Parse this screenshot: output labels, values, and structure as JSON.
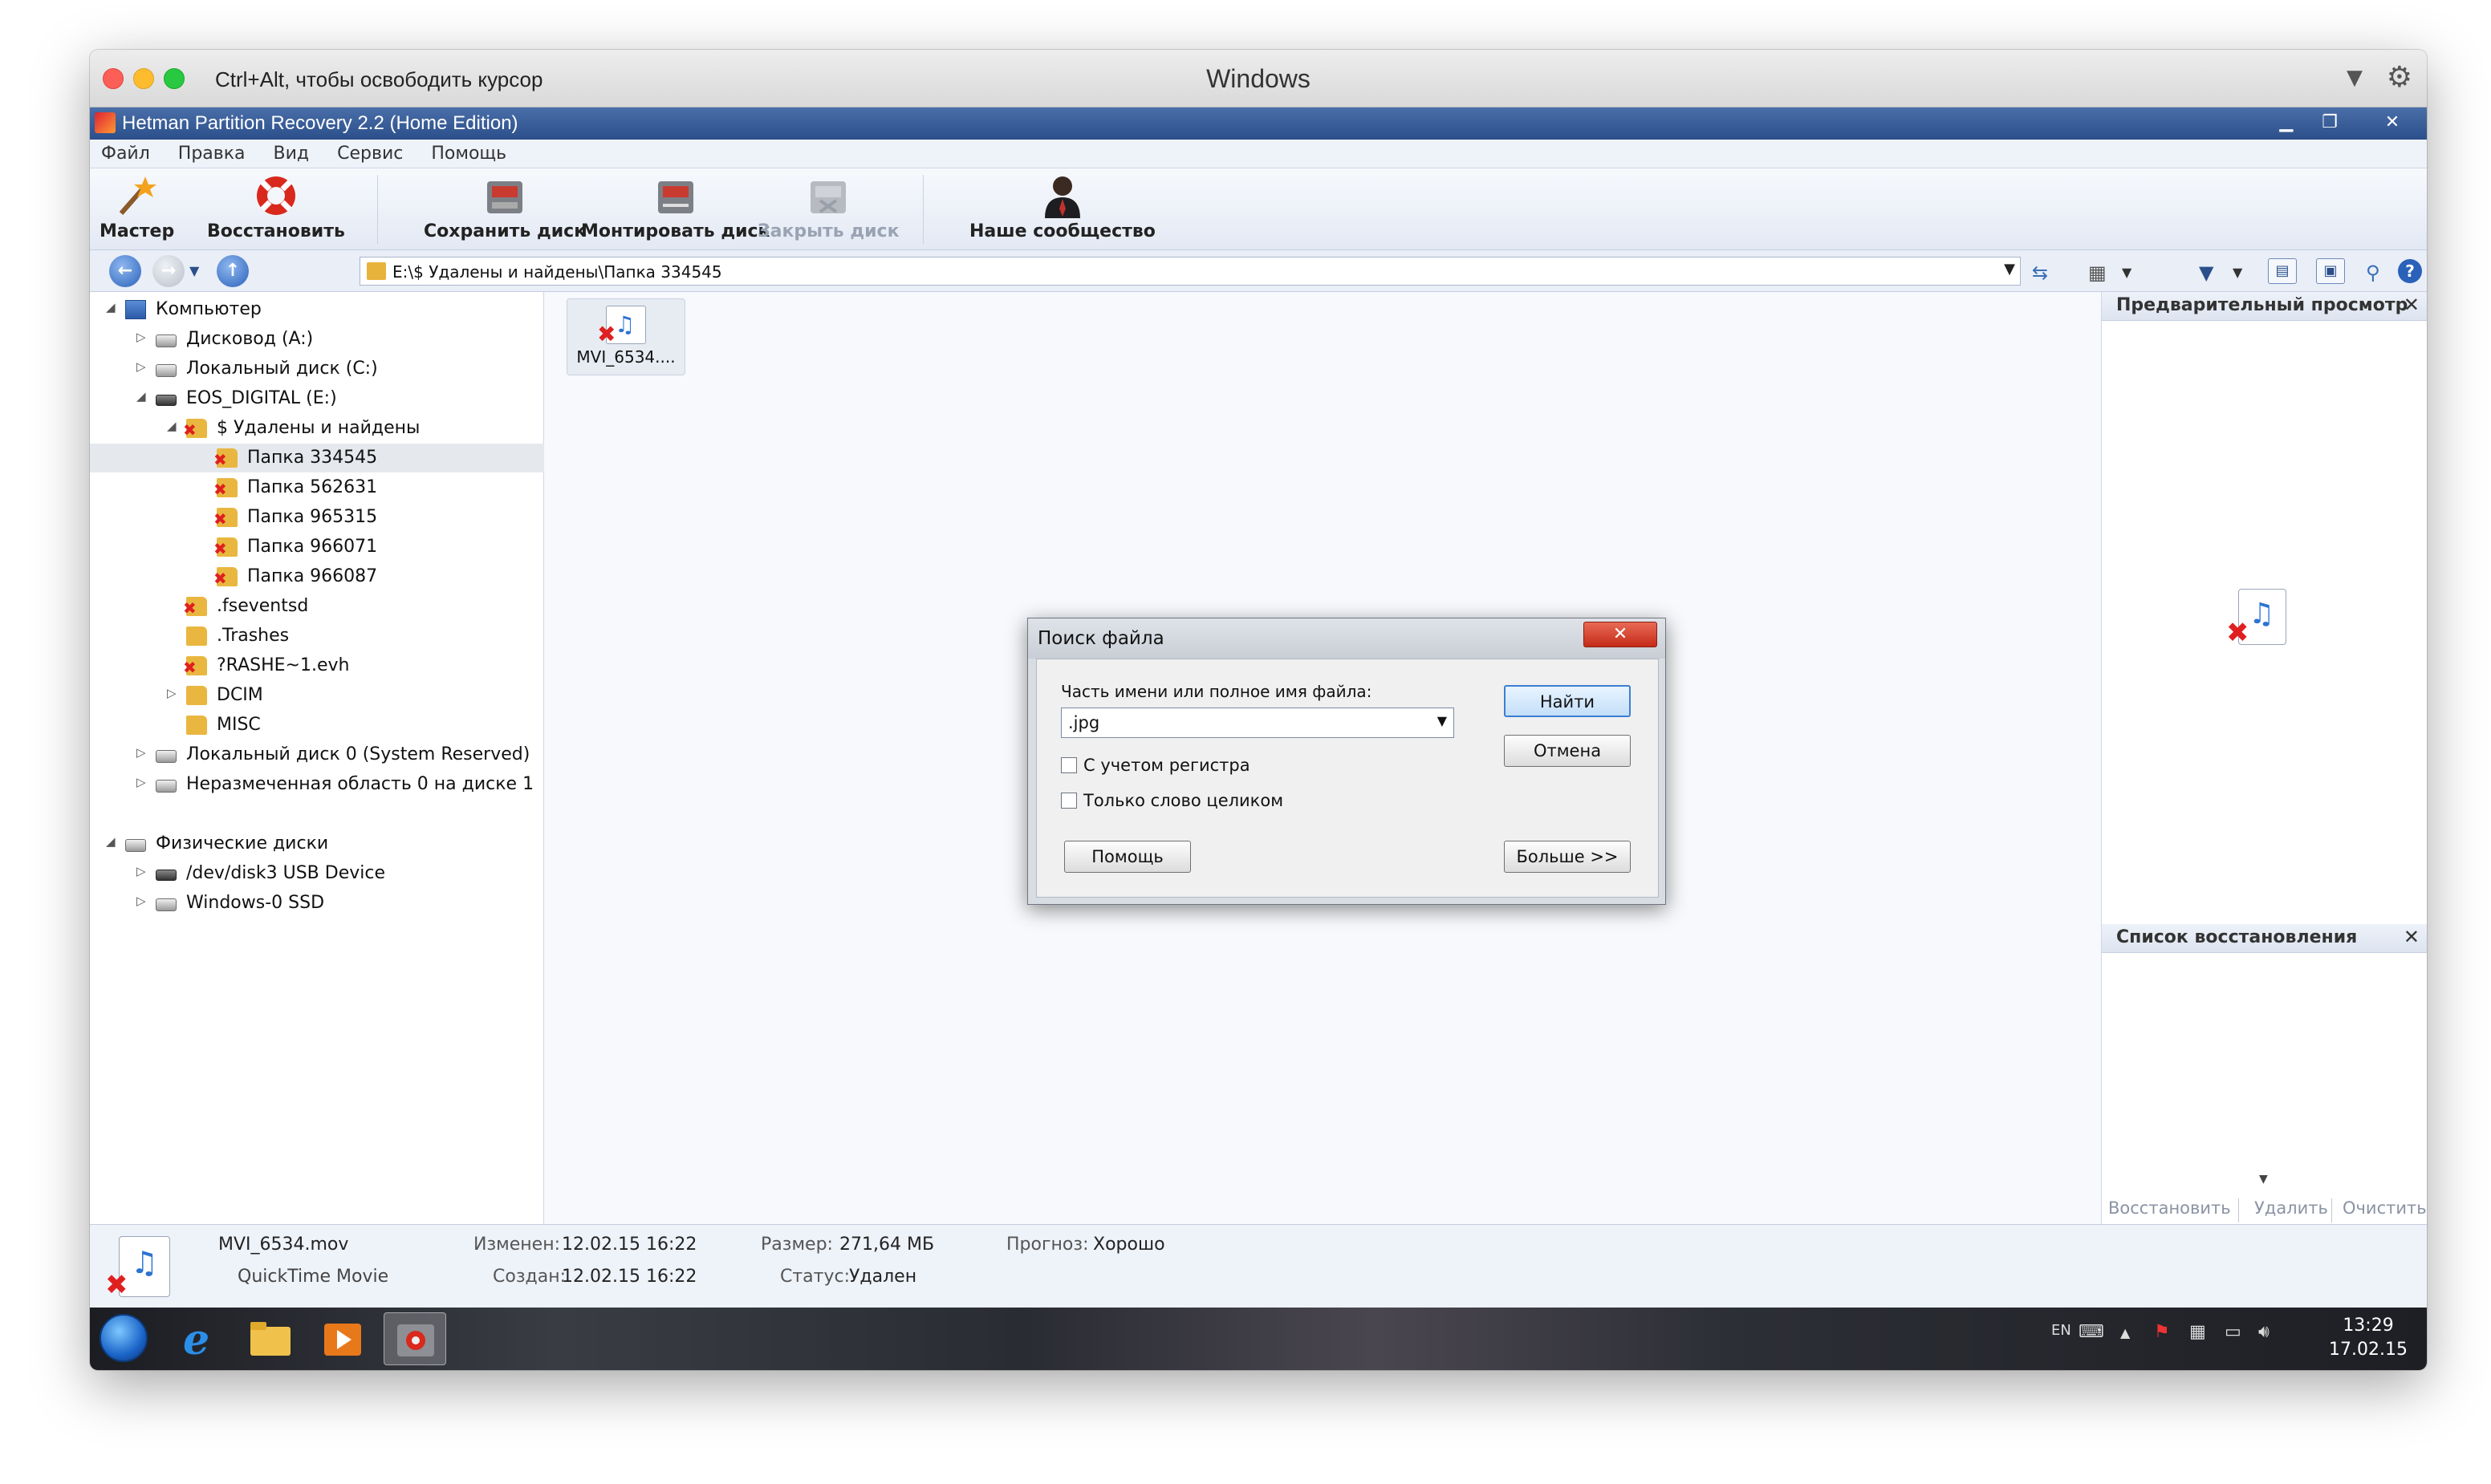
{
  "vm": {
    "hint": "Ctrl+Alt, чтобы освободить курсор",
    "title": "Windows"
  },
  "app": {
    "title": "Hetman Partition Recovery 2.2 (Home Edition)"
  },
  "menu": [
    "Файл",
    "Правка",
    "Вид",
    "Сервис",
    "Помощь"
  ],
  "toolbar": {
    "wizard": "Мастер",
    "restore": "Восстановить",
    "save_disk": "Сохранить диск",
    "mount_disk": "Монтировать диск",
    "close_disk": "Закрыть диск",
    "community": "Наше сообщество"
  },
  "address": {
    "path": "E:\\$ Удалены и найдены\\Папка 334545"
  },
  "tree": {
    "computer": "Компьютер",
    "drive_a": "Дисковод (A:)",
    "drive_c": "Локальный диск (C:)",
    "drive_e": "EOS_DIGITAL (E:)",
    "deleted_found": "$ Удалены и найдены",
    "folders": [
      "Папка 334545",
      "Папка 562631",
      "Папка 965315",
      "Папка 966071",
      "Папка 966087"
    ],
    "fseventsd": ".fseventsd",
    "trashes": ".Trashes",
    "rashe": "?RASHE~1.evh",
    "dcim": "DCIM",
    "misc": "MISC",
    "local_disk_0": "Локальный диск 0 (System Reserved)",
    "unallocated": "Неразмеченная область 0 на диске 1",
    "physical": "Физические диски",
    "usb": "/dev/disk3 USB Device",
    "ssd": "Windows-0 SSD"
  },
  "content": {
    "file_tile": "MVI_6534...."
  },
  "right": {
    "preview_title": "Предварительный просмотр",
    "recovery_list_title": "Список восстановления",
    "actions": {
      "restore": "Восстановить",
      "delete": "Удалить",
      "clear": "Очистить"
    }
  },
  "status": {
    "file_name": "MVI_6534.mov",
    "file_type": "QuickTime Movie",
    "modified_label": "Изменен:",
    "modified_value": "12.02.15 16:22",
    "created_label": "Создан:",
    "created_value": "12.02.15 16:22",
    "size_label": "Размер:",
    "size_value": "271,64 МБ",
    "status_label": "Статус:",
    "status_value": "Удален",
    "forecast_label": "Прогноз:",
    "forecast_value": "Хорошо"
  },
  "dialog": {
    "title": "Поиск файла",
    "label": "Часть имени или полное имя файла:",
    "input_value": ".jpg",
    "case_sensitive": "С учетом регистра",
    "whole_word": "Только слово целиком",
    "find": "Найти",
    "cancel": "Отмена",
    "help": "Помощь",
    "more": "Больше >>"
  },
  "taskbar": {
    "lang": "EN",
    "time": "13:29",
    "date": "17.02.15"
  }
}
